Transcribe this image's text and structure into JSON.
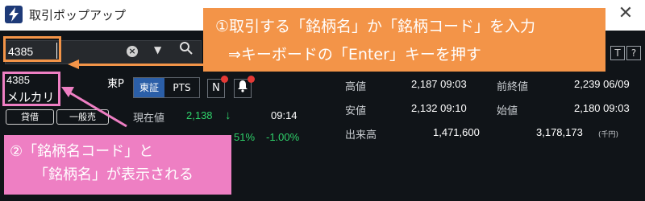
{
  "window": {
    "title": "取引ポップアップ",
    "close_icon": "close-icon"
  },
  "search": {
    "value": "4385",
    "clear_icon": "clear-icon",
    "dropdown_icon": "chevron-down-icon",
    "search_icon": "search-icon"
  },
  "stock": {
    "code": "4385",
    "name": "メルカリ",
    "market_code": "東P"
  },
  "tags": [
    "貸借",
    "一般売"
  ],
  "market_tabs": [
    "東証",
    "PTS"
  ],
  "buttons": {
    "news": "N",
    "alert_icon": "bell-icon"
  },
  "panel_icons": [
    "T",
    "?"
  ],
  "quote": {
    "current_label": "現在値",
    "current_price": "2,138",
    "current_arrow": "↓",
    "current_time": "09:14",
    "change": "51%",
    "change_pct": "-1.00%",
    "high_label": "高値",
    "high": "2,187 09:03",
    "prev_close_label": "前終値",
    "prev_close": "2,239 06/09",
    "low_label": "安値",
    "low": "2,132 09:10",
    "open_label": "始値",
    "open": "2,180 09:03",
    "volume_label": "出来高",
    "volume": "1,471,600",
    "turnover": "3,178,173",
    "turnover_unit": "(千円)"
  },
  "callouts": {
    "orange_line1": "①取引する「銘柄名」か「銘柄コード」を入力",
    "orange_line2": "⇒キーボードの「Enter」キーを押す",
    "pink_line1": "②「銘柄名コード」と",
    "pink_line2": "「銘柄名」が表示される"
  },
  "colors": {
    "orange": "#f39448",
    "pink": "#ee7fc3",
    "panel_bg": "#101418",
    "up_green": "#2fd16a",
    "tab_active": "#2b5fa8",
    "dot_red": "#e53935"
  }
}
